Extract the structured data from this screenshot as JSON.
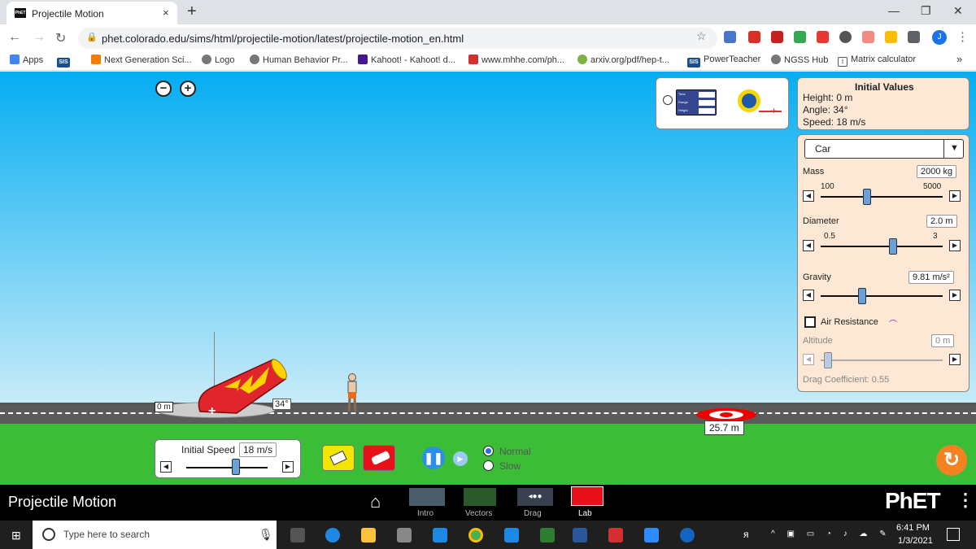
{
  "browser": {
    "tab_title": "Projectile Motion",
    "tab_close": "×",
    "new_tab": "+",
    "url": "phet.colorado.edu/sims/html/projectile-motion/latest/projectile-motion_en.html",
    "avatar_letter": "J",
    "window_controls": [
      "—",
      "❐",
      "✕"
    ]
  },
  "bookmarks": [
    {
      "label": "Apps",
      "icon": "apps-grid-icon"
    },
    {
      "label": "SIS",
      "icon": "sis-icon"
    },
    {
      "label": "Next Generation Sci...",
      "icon": "ngss-icon"
    },
    {
      "label": "Logo",
      "icon": "globe-icon"
    },
    {
      "label": "Human Behavior Pr...",
      "icon": "globe-icon"
    },
    {
      "label": "Kahoot! - Kahoot! d...",
      "icon": "kahoot-icon"
    },
    {
      "label": "www.mhhe.com/ph...",
      "icon": "mhhe-icon"
    },
    {
      "label": "arxiv.org/pdf/hep-t...",
      "icon": "smiley-icon"
    },
    {
      "label": "PowerTeacher",
      "icon": "sis-icon"
    },
    {
      "label": "NGSS Hub",
      "icon": "globe-icon"
    },
    {
      "label": "Matrix calculator",
      "icon": "matrix-icon"
    }
  ],
  "bookmarks_more": "»",
  "sim": {
    "zoom_out": "−",
    "zoom_in": "+",
    "initial_values": {
      "title": "Initial Values",
      "height": "Height: 0 m",
      "angle": "Angle: 34°",
      "speed": "Speed: 18 m/s"
    },
    "object_select": "Car",
    "mass": {
      "label": "Mass",
      "value": "2000 kg",
      "min": "100",
      "max": "5000",
      "fraction": 0.4
    },
    "diameter": {
      "label": "Diameter",
      "value": "2.0 m",
      "min": "0.5",
      "max": "3",
      "fraction": 0.6
    },
    "gravity": {
      "label": "Gravity",
      "value": "9.81 m/s²",
      "fraction": 0.3
    },
    "air_resistance": {
      "label": "Air Resistance",
      "checked": false
    },
    "altitude": {
      "label": "Altitude",
      "value": "0 m",
      "fraction": 0.0
    },
    "drag_coefficient": "Drag Coefficient: 0.55",
    "cannon_height_label": "0 m",
    "cannon_angle_label": "34°",
    "target_distance": "25.7 m",
    "initial_speed": {
      "label": "Initial Speed",
      "value": "18 m/s",
      "fraction": 0.6
    },
    "speed_modes": {
      "normal": "Normal",
      "slow": "Slow",
      "selected": "Normal"
    },
    "datatool": {
      "rows": [
        "Time",
        "Range",
        "Height"
      ]
    },
    "screen_title": "Projectile Motion",
    "screens": [
      "Intro",
      "Vectors",
      "Drag",
      "Lab"
    ],
    "active_screen": "Lab",
    "brand": "PhET"
  },
  "taskbar": {
    "search_placeholder": "Type here to search",
    "time": "6:41 PM",
    "date": "1/3/2021"
  }
}
